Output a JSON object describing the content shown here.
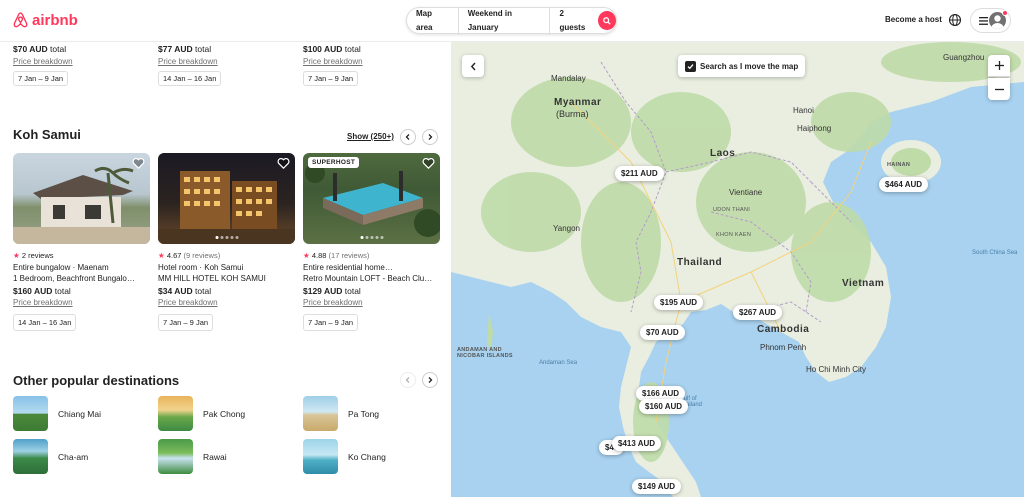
{
  "header": {
    "logo_text": "airbnb",
    "search": {
      "location": "Map area",
      "dates": "Weekend in January",
      "guests": "2 guests"
    },
    "become_host": "Become a host"
  },
  "top_prices": [
    {
      "price": "$70 AUD",
      "suffix": "total",
      "breakdown": "Price breakdown",
      "dates": "7 Jan – 9 Jan"
    },
    {
      "price": "$77 AUD",
      "suffix": "total",
      "breakdown": "Price breakdown",
      "dates": "14 Jan – 16 Jan"
    },
    {
      "price": "$100 AUD",
      "suffix": "total",
      "breakdown": "Price breakdown",
      "dates": "7 Jan – 9 Jan"
    }
  ],
  "koh_samui": {
    "title": "Koh Samui",
    "show_all": "Show (250+)",
    "cards": [
      {
        "rating": "2 reviews",
        "score": "",
        "reviews": "",
        "title": "Entire bungalow · Maenam",
        "sub": "1 Bedroom, Beachfront Bungalo…",
        "price": "$160 AUD",
        "suffix": "total",
        "breakdown": "Price breakdown",
        "dates": "14 Jan – 16 Jan",
        "superhost": ""
      },
      {
        "rating": "",
        "score": "4.67",
        "reviews": "(9 reviews)",
        "title": "Hotel room · Koh Samui",
        "sub": "MM HILL HOTEL KOH SAMUI",
        "price": "$34 AUD",
        "suffix": "total",
        "breakdown": "Price breakdown",
        "dates": "7 Jan – 9 Jan",
        "superhost": ""
      },
      {
        "rating": "",
        "score": "4.88",
        "reviews": "(17 reviews)",
        "title": "Entire residential home…",
        "sub": "Retro Mountain LOFT - Beach Clu…",
        "price": "$129 AUD",
        "suffix": "total",
        "breakdown": "Price breakdown",
        "dates": "7 Jan – 9 Jan",
        "superhost": "SUPERHOST"
      }
    ]
  },
  "destinations": {
    "title": "Other popular destinations",
    "items": [
      "Chiang Mai",
      "Pak Chong",
      "Pa Tong",
      "Cha-am",
      "Rawai",
      "Ko Chang"
    ]
  },
  "map": {
    "toggle_label": "Search as I move the map",
    "pins": [
      "$211 AUD",
      "$464 AUD",
      "$195 AUD",
      "$267 AUD",
      "$70 AUD",
      "$166 AUD",
      "$160 AUD",
      "$413 AUD",
      "$45",
      "$149 AUD"
    ],
    "labels": {
      "myanmar": "Myanmar",
      "burma": "(Burma)",
      "laos": "Laos",
      "thailand": "Thailand",
      "cambodia": "Cambodia",
      "vietnam": "Vietnam",
      "hainan": "HAINAN",
      "mandalay": "Mandalay",
      "hanoi": "Hanoi",
      "haiphong": "Haiphong",
      "guangzhou": "Guangzhou",
      "vientiane": "Vientiane",
      "udon": "UDON THANI",
      "bangkok_area": "KHON KAEN",
      "phnom_penh": "Phnom Penh",
      "hcmc": "Ho Chi Minh City",
      "andaman": "ANDAMAN AND NICOBAR ISLANDS",
      "andaman_sea": "Andaman Sea",
      "gulf": "Gulf of Thailand",
      "china_sea": "South China Sea",
      "yangon": "Yangon"
    }
  }
}
